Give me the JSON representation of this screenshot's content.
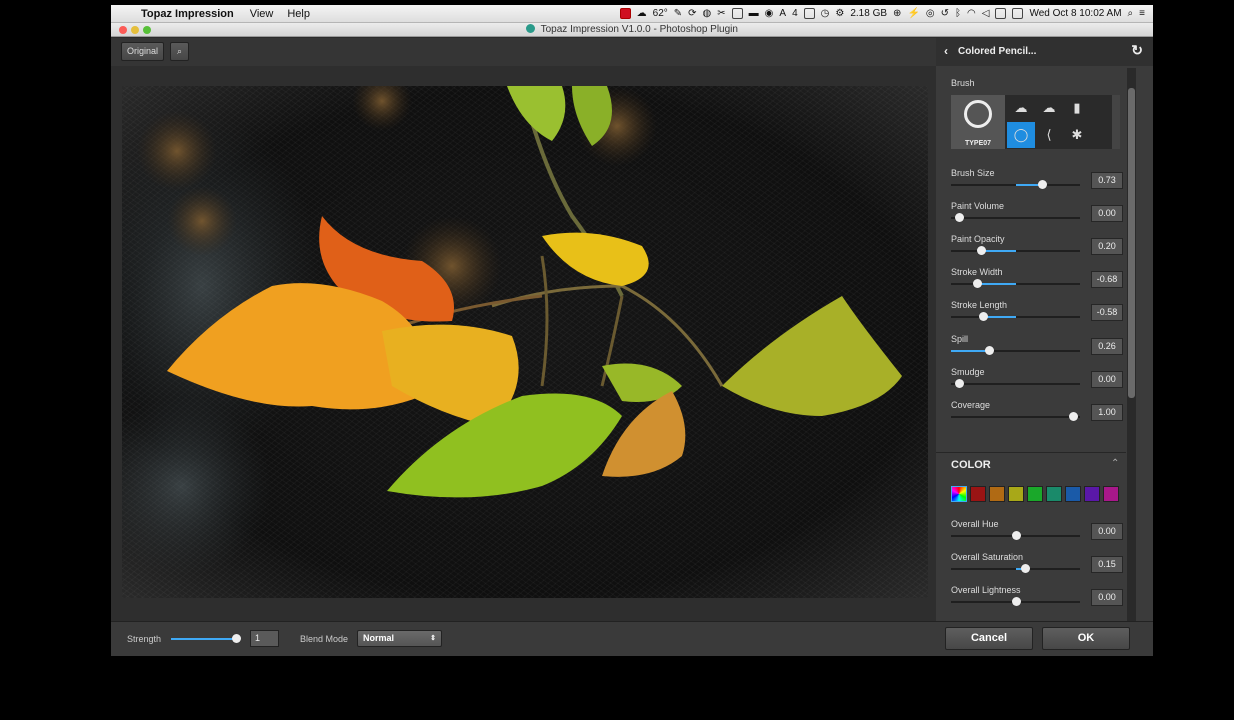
{
  "menubar": {
    "app_name": "Topaz Impression",
    "menus": [
      "View",
      "Help"
    ],
    "weather": "62°",
    "memory": "2.18 GB",
    "datetime": "Wed Oct 8  10:02 AM",
    "badge_count": "4"
  },
  "window": {
    "title": "Topaz Impression V1.0.0 - Photoshop Plugin"
  },
  "toolbar": {
    "original_label": "Original"
  },
  "panel": {
    "preset_title": "Colored Pencil...",
    "brush_label": "Brush",
    "brush_name": "TYPE07",
    "sliders": [
      {
        "label": "Brush Size",
        "value": "0.73"
      },
      {
        "label": "Paint Volume",
        "value": "0.00"
      },
      {
        "label": "Paint Opacity",
        "value": "0.20"
      },
      {
        "label": "Stroke Width",
        "value": "-0.68"
      },
      {
        "label": "Stroke Length",
        "value": "-0.58"
      },
      {
        "label": "Spill",
        "value": "0.26"
      },
      {
        "label": "Smudge",
        "value": "0.00"
      },
      {
        "label": "Coverage",
        "value": "1.00"
      }
    ],
    "color_heading": "COLOR",
    "swatch_colors": [
      "#9a1414",
      "#b06a14",
      "#a8a818",
      "#1aa82a",
      "#1a8a6a",
      "#1a5aa8",
      "#5a18a8",
      "#a8188a"
    ],
    "color_sliders": [
      {
        "label": "Overall Hue",
        "value": "0.00"
      },
      {
        "label": "Overall Saturation",
        "value": "0.15"
      },
      {
        "label": "Overall Lightness",
        "value": "0.00"
      }
    ]
  },
  "bottombar": {
    "strength_label": "Strength",
    "strength_value": "1",
    "blend_label": "Blend Mode",
    "blend_value": "Normal",
    "cancel_label": "Cancel",
    "ok_label": "OK"
  }
}
